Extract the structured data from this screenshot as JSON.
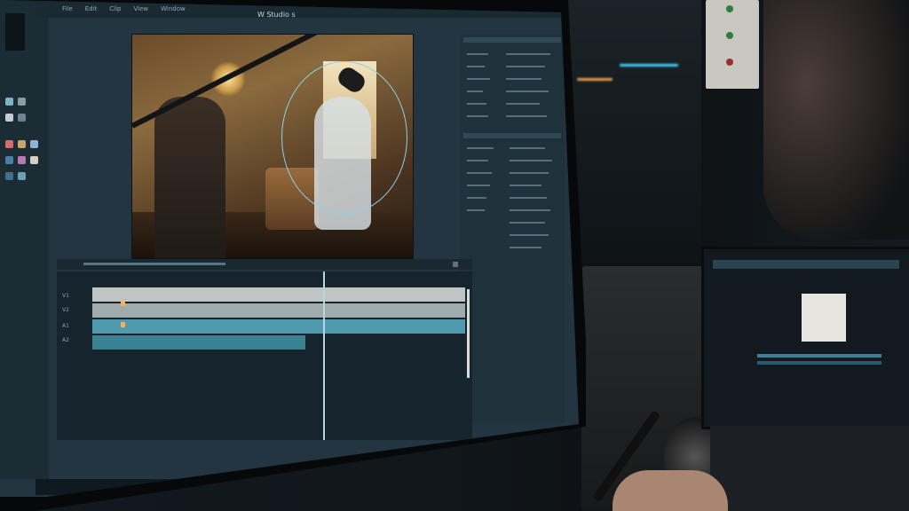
{
  "app": {
    "doc_title": "W Studio s"
  },
  "menubar": {
    "items": [
      "File",
      "Edit",
      "Clip",
      "View",
      "Window"
    ]
  },
  "viewer": {
    "scene": "video-frame-room"
  },
  "timeline": {
    "tracks": [
      "V1",
      "V2",
      "A1",
      "A2"
    ]
  },
  "taskbar": {
    "icons": [
      "app-icon-1",
      "app-icon-2",
      "app-icon-3",
      "app-icon-4",
      "app-icon-5",
      "app-icon-6",
      "app-icon-7",
      "app-icon-8"
    ]
  },
  "colors": {
    "accent": "#3ea6c3",
    "track_light": "#d8dcd9",
    "track_teal": "#4f9aae",
    "mask_outline": "#8ad3ea"
  }
}
